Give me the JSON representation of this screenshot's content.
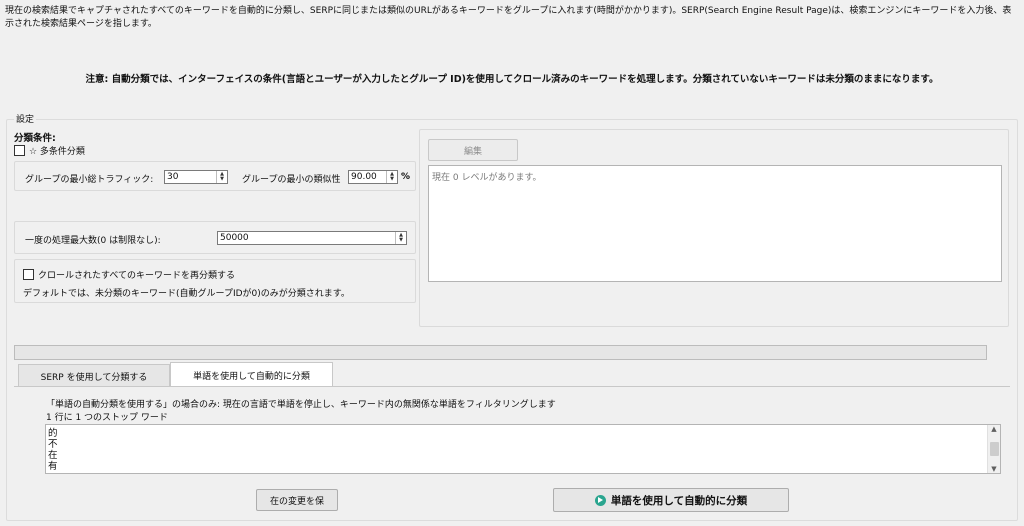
{
  "description": "現在の検索結果でキャプチャされたすべてのキーワードを自動的に分類し、SERPに同じまたは類似のURLがあるキーワードをグループに入れます(時間がかかります)。SERP(Search Engine Result Page)は、検索エンジンにキーワードを入力後、表示された検索結果ページを指します。",
  "note": "注意: 自動分類では、インターフェイスの条件(言語とユーザーが入力したとグループ ID)を使用してクロール済みのキーワードを処理します。分類されていないキーワードは未分類のままになります。",
  "settings": {
    "legend": "設定",
    "condition_label": "分類条件:",
    "multi_condition": "☆ 多条件分類",
    "min_traffic_label": "グループの最小総トラフィック:",
    "min_traffic_value": "30",
    "min_similarity_label": "グループの最小の類似性",
    "min_similarity_value": "90.00",
    "percent": "%",
    "max_process_label": "一度の処理最大数(0 は制限なし):",
    "max_process_value": "50000",
    "reclassify_label": "クロールされたすべてのキーワードを再分類する",
    "default_note": "デフォルトでは、未分類のキーワード(自動グループIDが0)のみが分類されます。"
  },
  "levels": {
    "edit_button": "編集",
    "status": "現在 0 レベルがあります。"
  },
  "tabs": [
    {
      "label": "SERP を使用して分類する"
    },
    {
      "label": "単語を使用して自動的に分類"
    }
  ],
  "words_tab": {
    "info": "「単語の自動分類を使用する」の場合のみ: 現在の言語で単語を停止し、キーワード内の無関係な単語をフィルタリングします",
    "stopword_label": "1 行に 1 つのストップ ワード",
    "stopwords": [
      "的",
      "不",
      "在",
      "有"
    ],
    "save_button": "在の変更を保",
    "classify_button": "単語を使用して自動的に分類"
  },
  "colors": {
    "background": "#f0f0f0",
    "run_icon": "#2aa58f"
  }
}
